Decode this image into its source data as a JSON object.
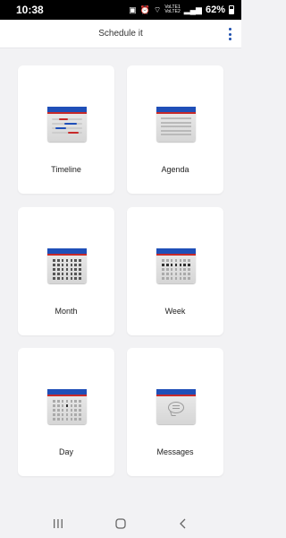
{
  "status_bar": {
    "time": "10:38",
    "battery": "62%",
    "icons": [
      "notification-icon",
      "alarm-icon",
      "wifi-icon",
      "volte-icon",
      "signal-icon",
      "battery-icon"
    ],
    "volte_1": "VoLTE1",
    "volte_2": "VoLTE2"
  },
  "app_bar": {
    "title": "Schedule it",
    "menu_icon": "more-vert-icon"
  },
  "tiles": [
    {
      "label": "Timeline",
      "icon": "timeline-calendar-icon"
    },
    {
      "label": "Agenda",
      "icon": "agenda-calendar-icon"
    },
    {
      "label": "Month",
      "icon": "month-calendar-icon"
    },
    {
      "label": "Week",
      "icon": "week-calendar-icon"
    },
    {
      "label": "Day",
      "icon": "day-calendar-icon"
    },
    {
      "label": "Messages",
      "icon": "messages-calendar-icon"
    }
  ],
  "navigation": {
    "recents": "recents-icon",
    "home": "home-icon",
    "back": "back-icon"
  },
  "colors": {
    "calendar_header": "#1f4fb8",
    "calendar_stripe": "#c72a2a",
    "menu_dots": "#1d4fae",
    "background": "#f2f2f4"
  }
}
